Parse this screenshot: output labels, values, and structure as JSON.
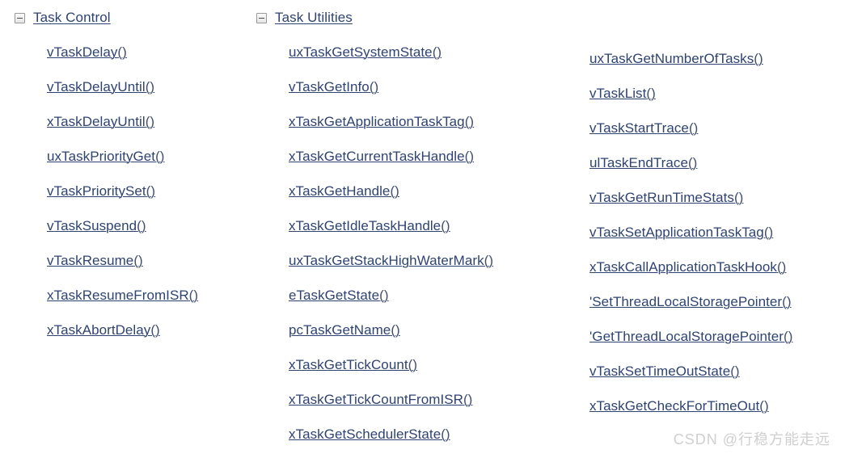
{
  "page": {
    "background_color": "#ffffff",
    "link_color": "#2f4372",
    "watermark_color": "#cfcfcf"
  },
  "watermark": {
    "text": "CSDN @行稳方能走远"
  },
  "columns": [
    {
      "id": "task-control",
      "header": {
        "icon": "collapse-minus-box-icon",
        "title": "Task Control"
      },
      "items": [
        {
          "name": "vTaskDelay",
          "paren": "()"
        },
        {
          "name": "vTaskDelayUntil",
          "paren": "()"
        },
        {
          "name": "xTaskDelayUntil",
          "paren": "()"
        },
        {
          "name": "uxTaskPriorityGet",
          "paren": "()"
        },
        {
          "name": "vTaskPrioritySet",
          "paren": "()"
        },
        {
          "name": "vTaskSuspend",
          "paren": "()"
        },
        {
          "name": "vTaskResume",
          "paren": "()"
        },
        {
          "name": "xTaskResumeFromISR",
          "paren": "()"
        },
        {
          "name": "xTaskAbortDelay",
          "paren": "()"
        }
      ]
    },
    {
      "id": "task-utilities",
      "header": {
        "icon": "collapse-minus-box-icon",
        "title": "Task Utilities"
      },
      "items": [
        {
          "name": "uxTaskGetSystemState",
          "paren": "()"
        },
        {
          "name": "vTaskGetInfo",
          "paren": "()"
        },
        {
          "name": "xTaskGetApplicationTaskTag",
          "paren": "()"
        },
        {
          "name": "xTaskGetCurrentTaskHandle",
          "paren": "()"
        },
        {
          "name": "xTaskGetHandle",
          "paren": "()"
        },
        {
          "name": "xTaskGetIdleTaskHandle",
          "paren": "()"
        },
        {
          "name": "uxTaskGetStackHighWaterMark",
          "paren": "()"
        },
        {
          "name": "eTaskGetState",
          "paren": "()"
        },
        {
          "name": "pcTaskGetName",
          "paren": "()"
        },
        {
          "name": "xTaskGetTickCount",
          "paren": "()"
        },
        {
          "name": "xTaskGetTickCountFromISR",
          "paren": "()"
        },
        {
          "name": "xTaskGetSchedulerState",
          "paren": "()"
        }
      ]
    },
    {
      "id": "task-utilities-continued",
      "header": null,
      "items": [
        {
          "name": "uxTaskGetNumberOfTasks",
          "paren": "()"
        },
        {
          "name": "vTaskList",
          "paren": "()"
        },
        {
          "name": "vTaskStartTrace",
          "paren": "()"
        },
        {
          "name": "ulTaskEndTrace",
          "paren": "()"
        },
        {
          "name": "vTaskGetRunTimeStats",
          "paren": "()"
        },
        {
          "name": "vTaskSetApplicationTaskTag",
          "paren": "()"
        },
        {
          "name": "xTaskCallApplicationTaskHook",
          "paren": "()"
        },
        {
          "name": "'SetThreadLocalStoragePointer",
          "paren": "()"
        },
        {
          "name": "'GetThreadLocalStoragePointer",
          "paren": "()"
        },
        {
          "name": "vTaskSetTimeOutState",
          "paren": "()"
        },
        {
          "name": "xTaskGetCheckForTimeOut",
          "paren": "()"
        }
      ]
    }
  ]
}
